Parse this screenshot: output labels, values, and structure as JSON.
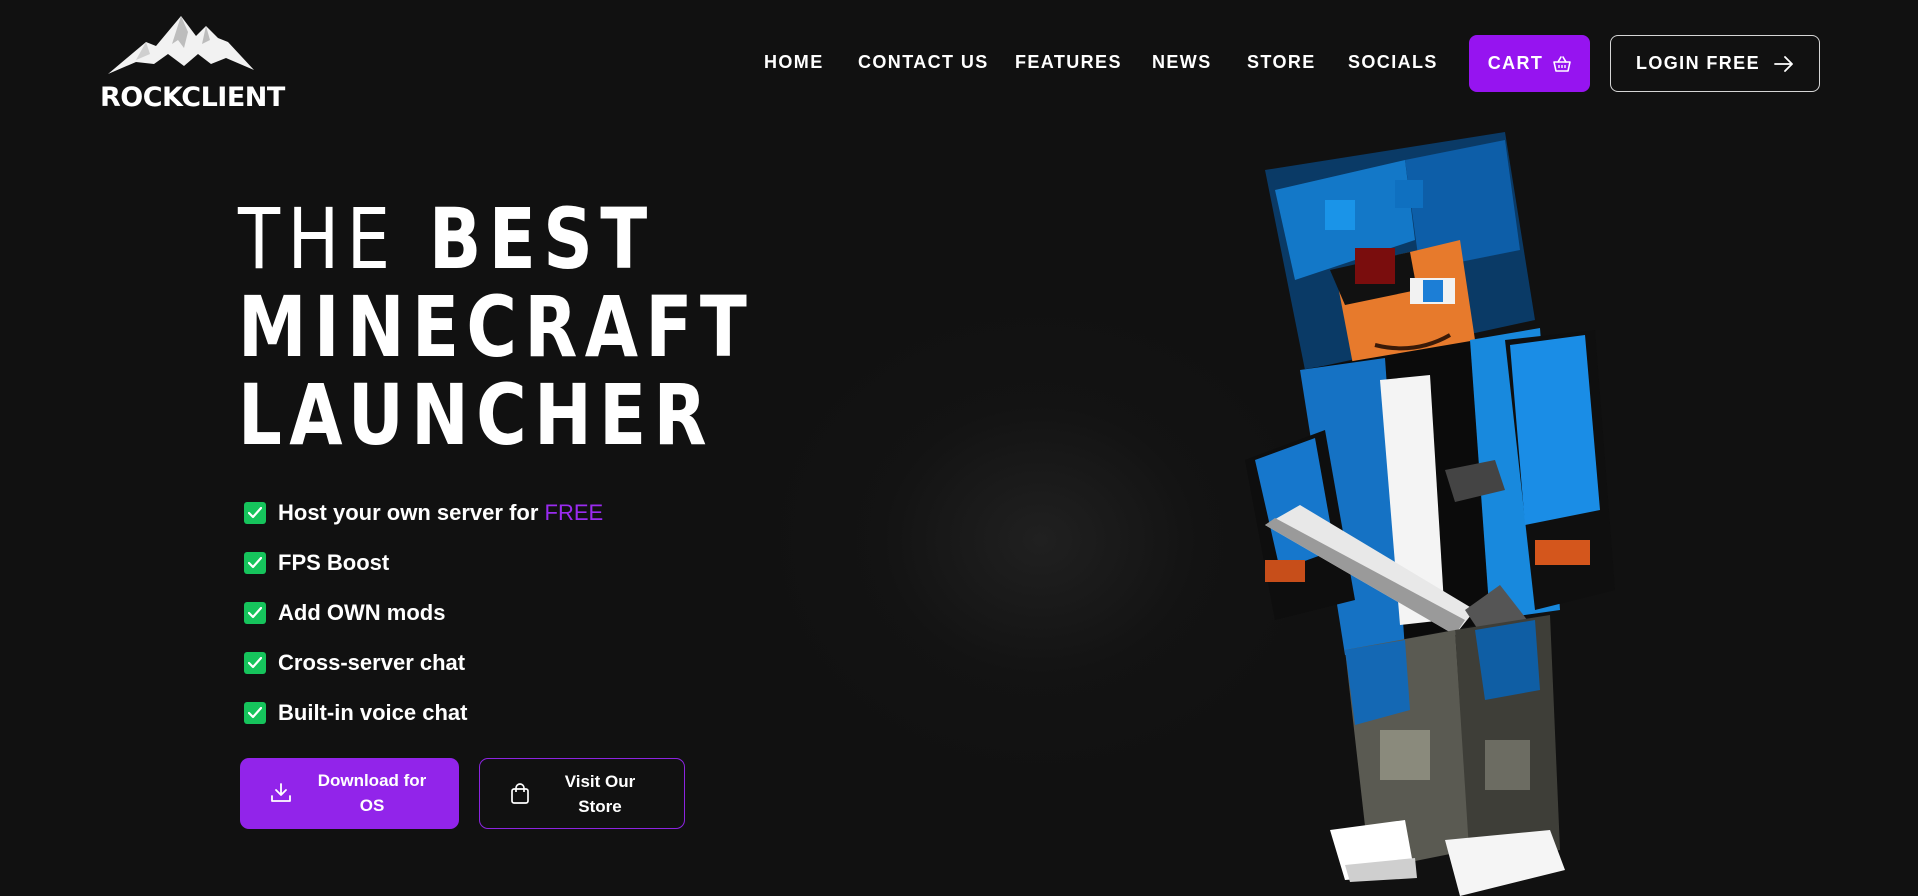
{
  "brand": {
    "name": "ROCKCLIENT"
  },
  "nav": {
    "items": [
      "HOME",
      "CONTACT US",
      "FEATURES",
      "NEWS",
      "STORE",
      "SOCIALS"
    ],
    "cart_label": "CART",
    "login_label": "LOGIN FREE"
  },
  "hero": {
    "title_line1_thin": "THE",
    "title_line1_bold": "BEST",
    "title_line2": "MINECRAFT",
    "title_line3": "LAUNCHER"
  },
  "features": [
    {
      "text": "Host your own server for ",
      "accent": "FREE"
    },
    {
      "text": "FPS Boost"
    },
    {
      "text": "Add OWN mods"
    },
    {
      "text": "Cross-server chat"
    },
    {
      "text": "Built-in voice chat"
    }
  ],
  "cta": {
    "download_line1": "Download for",
    "download_line2": "OS",
    "store_line1": "Visit Our",
    "store_line2": "Store"
  },
  "colors": {
    "background": "#111111",
    "accent_purple": "#9614f0",
    "accent_green": "#16c45c",
    "text": "#ffffff"
  },
  "icons": {
    "cart": "basket-icon",
    "login": "arrow-right-icon",
    "feature": "checkbox-checked-icon",
    "download": "download-icon",
    "store": "shopping-bag-icon"
  }
}
